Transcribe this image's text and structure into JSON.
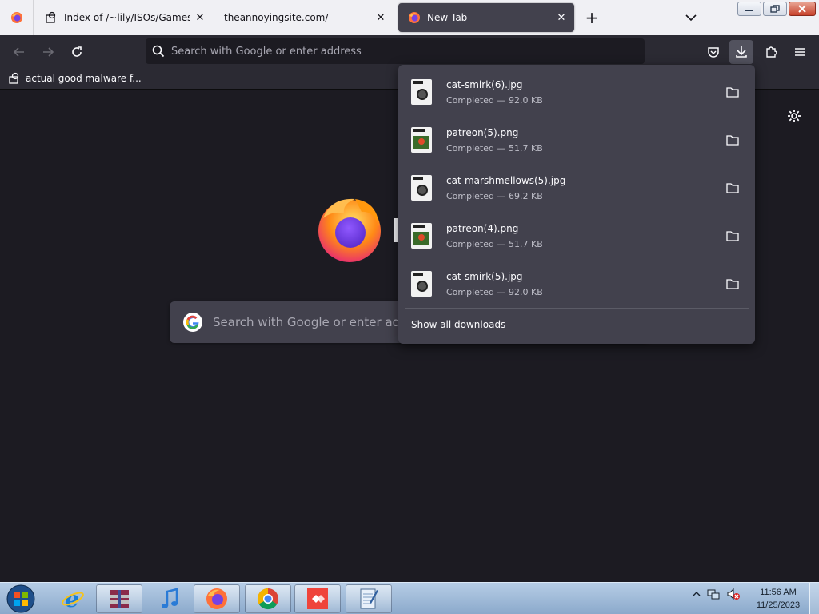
{
  "tabs": [
    {
      "title": "Index of /~lily/ISOs/Games/",
      "icon": "site-favicon",
      "active": false
    },
    {
      "title": "theannoyingsite.com/",
      "icon": "",
      "active": false
    },
    {
      "title": "New Tab",
      "icon": "firefox-favicon",
      "active": true
    }
  ],
  "tab_close_glyph": "✕",
  "new_tab_glyph": "+",
  "urlbar": {
    "placeholder": "Search with Google or enter address"
  },
  "bookmarks": [
    {
      "label": "actual good malware f..."
    }
  ],
  "newtab": {
    "search_placeholder": "Search with Google or enter address"
  },
  "downloads": {
    "items": [
      {
        "name": "cat-smirk(6).jpg",
        "status": "Completed — 92.0 KB",
        "kind": "jpg"
      },
      {
        "name": "patreon(5).png",
        "status": "Completed — 51.7 KB",
        "kind": "png"
      },
      {
        "name": "cat-marshmellows(5).jpg",
        "status": "Completed — 69.2 KB",
        "kind": "jpg"
      },
      {
        "name": "patreon(4).png",
        "status": "Completed — 51.7 KB",
        "kind": "png"
      },
      {
        "name": "cat-smirk(5).jpg",
        "status": "Completed — 92.0 KB",
        "kind": "jpg"
      }
    ],
    "show_all": "Show all downloads"
  },
  "taskbar": {
    "clock_time": "11:56 AM",
    "clock_date": "11/25/2023",
    "items": [
      "internet-explorer-icon",
      "winrar-icon",
      "itunes-icon",
      "firefox-icon",
      "chrome-icon",
      "anydesk-icon",
      "notepad-icon"
    ]
  },
  "colors": {
    "accent": "#42414d",
    "content_bg": "#1c1b22",
    "toolbar_bg": "#2b2a33"
  }
}
